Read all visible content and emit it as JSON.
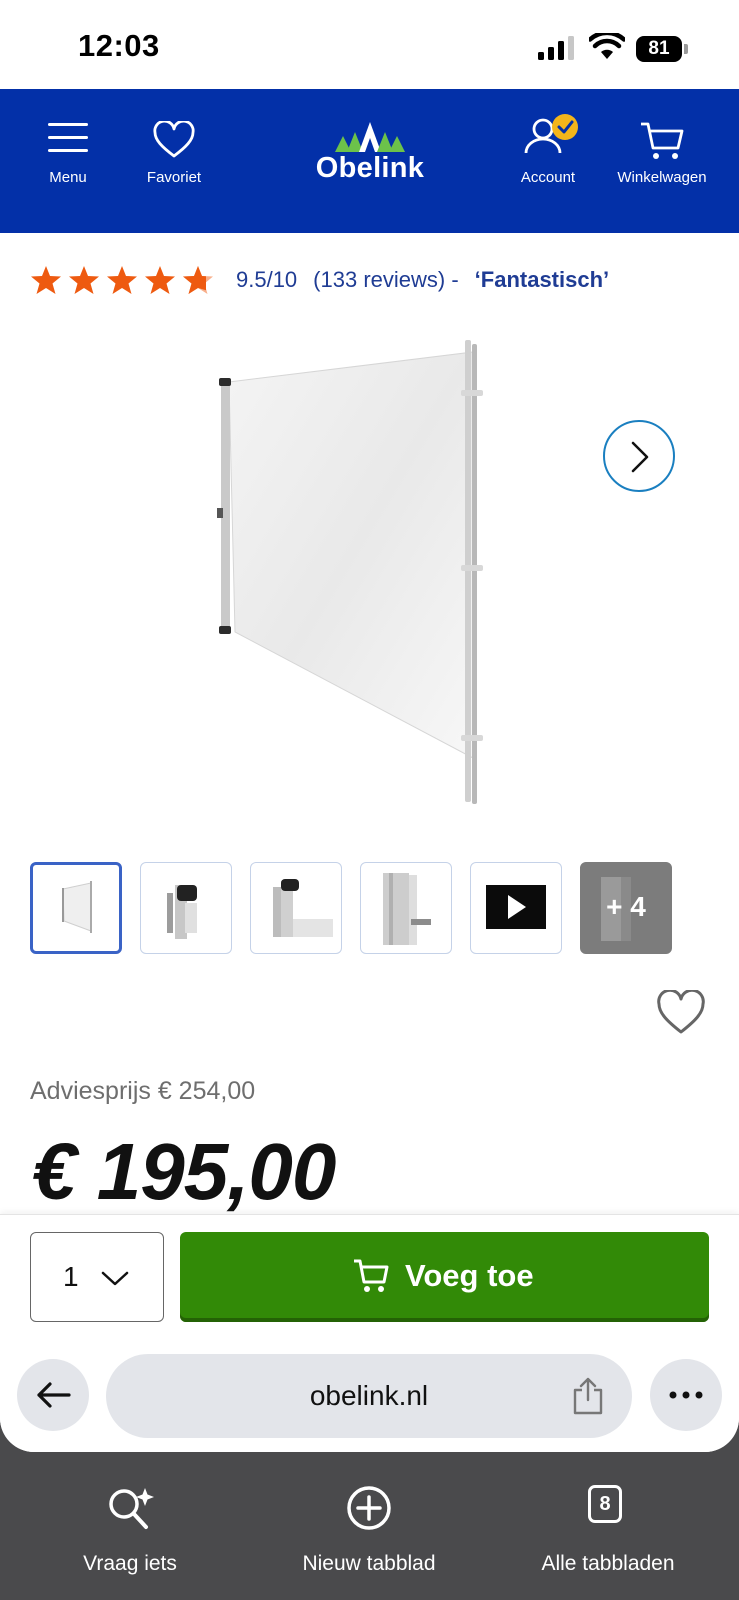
{
  "status_bar": {
    "time": "12:03",
    "battery": "81"
  },
  "header": {
    "menu_label": "Menu",
    "favorites_label": "Favoriet",
    "logo_text": "Obelink",
    "account_label": "Account",
    "cart_label": "Winkelwagen",
    "brand_color": "#0330a8"
  },
  "rating": {
    "stars": 4.5,
    "score": "9.5/10",
    "reviews": "(133 reviews) -",
    "verdict": "‘Fantastisch’"
  },
  "gallery": {
    "more_label": "+ 4"
  },
  "price": {
    "advice": "Adviesprijs € 254,00",
    "current": "€ 195,00"
  },
  "cart": {
    "quantity": "1",
    "add_label": "Voeg toe",
    "button_color": "#328a07"
  },
  "browser": {
    "url": "obelink.nl"
  },
  "tabbar": {
    "ask_label": "Vraag iets",
    "new_tab_label": "Nieuw tabblad",
    "all_tabs_label": "Alle tabbladen",
    "tab_count": "8"
  }
}
